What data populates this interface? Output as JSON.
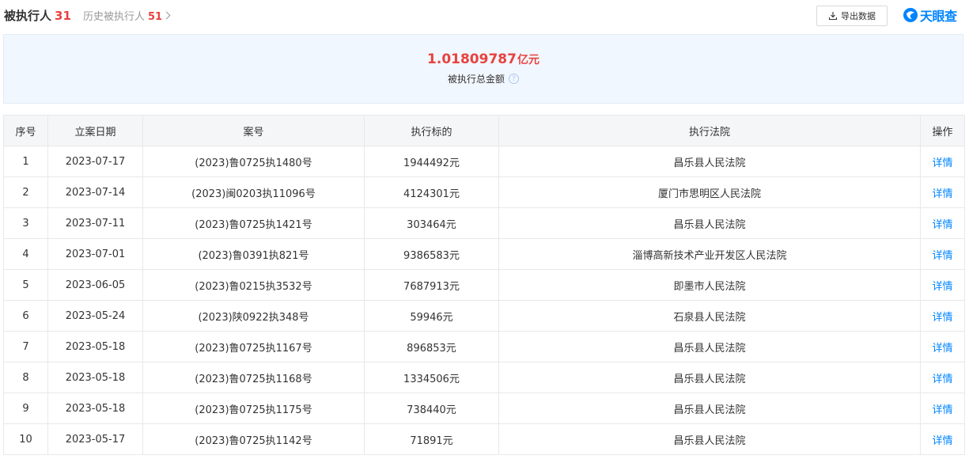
{
  "tabs": {
    "current": {
      "label": "被执行人",
      "count": "31"
    },
    "history": {
      "label": "历史被执行人",
      "count": "51"
    }
  },
  "toolbar": {
    "export_label": "导出数据"
  },
  "brand": {
    "name": "天眼查",
    "color": "#0084ff"
  },
  "summary": {
    "amount": "1.01809787",
    "unit": "亿元",
    "label": "被执行总金额"
  },
  "table": {
    "headers": [
      "序号",
      "立案日期",
      "案号",
      "执行标的",
      "执行法院",
      "操作"
    ],
    "rows": [
      [
        "1",
        "2023-07-17",
        "(2023)鲁0725执1480号",
        "1944492元",
        "昌乐县人民法院",
        "详情"
      ],
      [
        "2",
        "2023-07-14",
        "(2023)闽0203执11096号",
        "4124301元",
        "厦门市思明区人民法院",
        "详情"
      ],
      [
        "3",
        "2023-07-11",
        "(2023)鲁0725执1421号",
        "303464元",
        "昌乐县人民法院",
        "详情"
      ],
      [
        "4",
        "2023-07-01",
        "(2023)鲁0391执821号",
        "9386583元",
        "淄博高新技术产业开发区人民法院",
        "详情"
      ],
      [
        "5",
        "2023-06-05",
        "(2023)鲁0215执3532号",
        "7687913元",
        "即墨市人民法院",
        "详情"
      ],
      [
        "6",
        "2023-05-24",
        "(2023)陕0922执348号",
        "59946元",
        "石泉县人民法院",
        "详情"
      ],
      [
        "7",
        "2023-05-18",
        "(2023)鲁0725执1167号",
        "896853元",
        "昌乐县人民法院",
        "详情"
      ],
      [
        "8",
        "2023-05-18",
        "(2023)鲁0725执1168号",
        "1334506元",
        "昌乐县人民法院",
        "详情"
      ],
      [
        "9",
        "2023-05-18",
        "(2023)鲁0725执1175号",
        "738440元",
        "昌乐县人民法院",
        "详情"
      ],
      [
        "10",
        "2023-05-17",
        "(2023)鲁0725执1142号",
        "71891元",
        "昌乐县人民法院",
        "详情"
      ]
    ]
  },
  "colors": {
    "accent": "#e8423f",
    "link": "#0084ff",
    "header_bg": "#f4f6f8",
    "summary_bg": "#f1f7fe"
  }
}
